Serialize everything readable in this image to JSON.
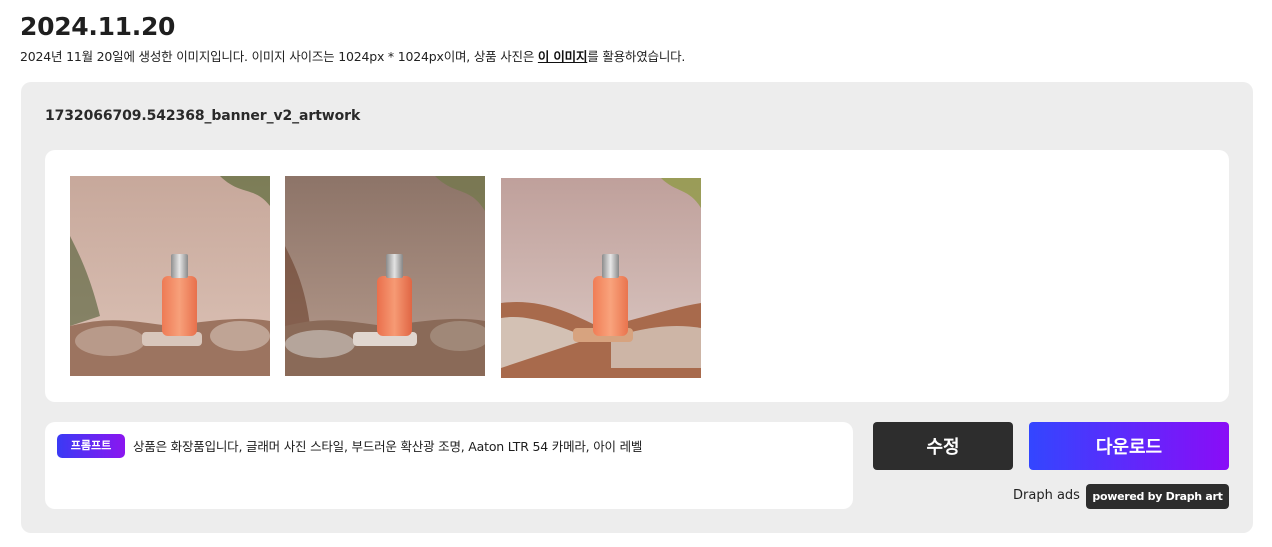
{
  "header": {
    "date": "2024.11.20",
    "description_before": "2024년 11월 20일에 생성한 이미지입니다. 이미지 사이즈는 1024px * 1024px이며, 상품 사진은 ",
    "description_link": "이 이미지",
    "description_after": "를 활용하였습니다."
  },
  "card": {
    "title": "1732066709.542368_banner_v2_artwork",
    "images": [
      {
        "name": "generated-image-1",
        "bg": "#c9aa9d",
        "bottle": "#f2855e"
      },
      {
        "name": "generated-image-2",
        "bg": "#a98d80",
        "bottle": "#ef7b58"
      },
      {
        "name": "generated-image-3",
        "bg": "#c6a8a2",
        "bottle": "#f38a5f"
      }
    ],
    "prompt_label": "프롬프트",
    "prompt_text": "상품은 화장품입니다, 글래머 사진 스타일, 부드러운 확산광 조명, Aaton LTR 54 카메라, 아이 레벨"
  },
  "actions": {
    "edit_label": "수정",
    "download_label": "다운로드",
    "ads_label": "Draph ads",
    "powered_label": "powered by Draph art"
  },
  "colors": {
    "accent_gradient_start": "#3346ff",
    "accent_gradient_end": "#8a0cf7",
    "dark_button": "#2d2d2d",
    "card_bg": "#ededed"
  }
}
